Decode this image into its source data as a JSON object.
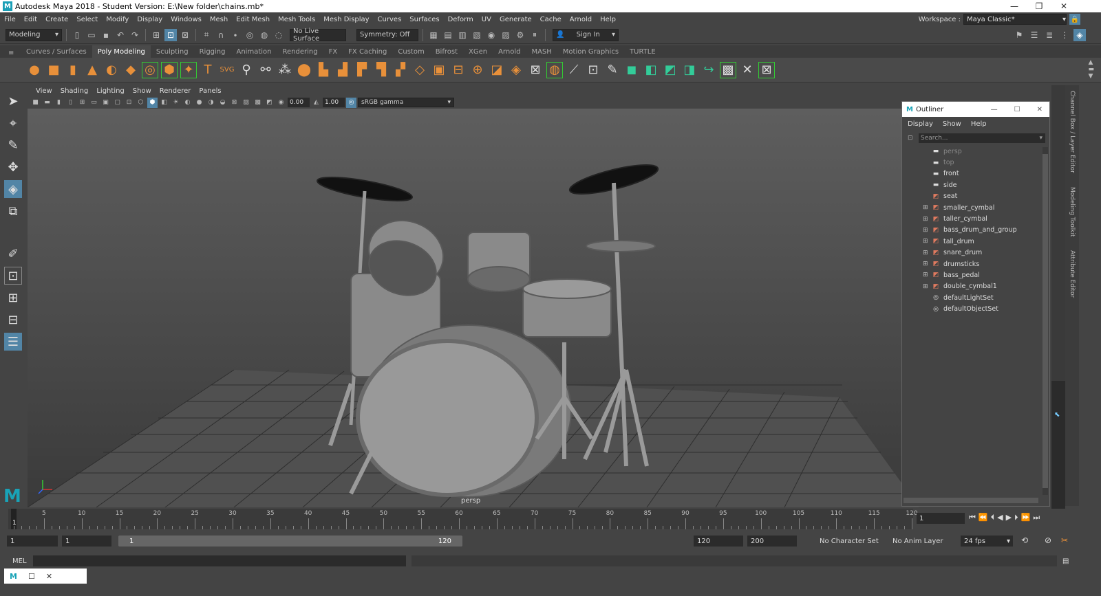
{
  "titlebar": {
    "title": "Autodesk Maya 2018 - Student Version: E:\\New folder\\chains.mb*",
    "logo": "M"
  },
  "menubar": {
    "items": [
      "File",
      "Edit",
      "Create",
      "Select",
      "Modify",
      "Display",
      "Windows",
      "Mesh",
      "Edit Mesh",
      "Mesh Tools",
      "Mesh Display",
      "Curves",
      "Surfaces",
      "Deform",
      "UV",
      "Generate",
      "Cache",
      "Arnold",
      "Help"
    ]
  },
  "workspace": {
    "label": "Workspace :",
    "value": "Maya Classic*"
  },
  "statusline": {
    "menuset": "Modeling",
    "live_surface": "No Live Surface",
    "symmetry": "Symmetry: Off",
    "sign_in": "Sign In"
  },
  "shelf": {
    "tabs": [
      "Curves / Surfaces",
      "Poly Modeling",
      "Sculpting",
      "Rigging",
      "Animation",
      "Rendering",
      "FX",
      "FX Caching",
      "Custom",
      "Bifrost",
      "XGen",
      "Arnold",
      "MASH",
      "Motion Graphics",
      "TURTLE"
    ],
    "active_tab": "Poly Modeling"
  },
  "viewport": {
    "menu": [
      "View",
      "Shading",
      "Lighting",
      "Show",
      "Renderer",
      "Panels"
    ],
    "exposure": "0.00",
    "gamma": "1.00",
    "color_space": "sRGB gamma",
    "camera_label": "persp"
  },
  "outliner": {
    "title": "Outliner",
    "menu": [
      "Display",
      "Show",
      "Help"
    ],
    "search_placeholder": "Search...",
    "items": [
      {
        "name": "persp",
        "type": "camera",
        "dim": true,
        "expand": false
      },
      {
        "name": "top",
        "type": "camera",
        "dim": true,
        "expand": false
      },
      {
        "name": "front",
        "type": "camera",
        "dim": false,
        "expand": false
      },
      {
        "name": "side",
        "type": "camera",
        "dim": false,
        "expand": false
      },
      {
        "name": "seat",
        "type": "mesh",
        "dim": false,
        "expand": false
      },
      {
        "name": "smaller_cymbal",
        "type": "mesh",
        "dim": false,
        "expand": true
      },
      {
        "name": "taller_cymbal",
        "type": "mesh",
        "dim": false,
        "expand": true
      },
      {
        "name": "bass_drum_and_group",
        "type": "mesh",
        "dim": false,
        "expand": true
      },
      {
        "name": "tall_drum",
        "type": "mesh",
        "dim": false,
        "expand": true
      },
      {
        "name": "snare_drum",
        "type": "mesh",
        "dim": false,
        "expand": true
      },
      {
        "name": "drumsticks",
        "type": "mesh",
        "dim": false,
        "expand": true
      },
      {
        "name": "bass_pedal",
        "type": "mesh",
        "dim": false,
        "expand": true
      },
      {
        "name": "double_cymbal1",
        "type": "mesh",
        "dim": false,
        "expand": true
      },
      {
        "name": "defaultLightSet",
        "type": "set",
        "dim": false,
        "expand": false
      },
      {
        "name": "defaultObjectSet",
        "type": "set",
        "dim": false,
        "expand": false
      }
    ]
  },
  "right_panel_labels": [
    "Channel Box / Layer Editor",
    "Modeling Toolkit",
    "Attribute Editor"
  ],
  "timeline": {
    "ticks": [
      "5",
      "10",
      "15",
      "20",
      "25",
      "30",
      "35",
      "40",
      "45",
      "50",
      "55",
      "60",
      "65",
      "70",
      "75",
      "80",
      "85",
      "90",
      "95",
      "100",
      "105",
      "110",
      "115",
      "120"
    ],
    "start_marker": "1",
    "current_frame": "1"
  },
  "range": {
    "start": "1",
    "playback_start": "1",
    "slider_start": "1",
    "slider_end": "120",
    "playback_end": "120",
    "end": "200",
    "character_set": "No Character Set",
    "anim_layer": "No Anim Layer",
    "fps": "24 fps"
  },
  "cmdline": {
    "label": "MEL"
  }
}
